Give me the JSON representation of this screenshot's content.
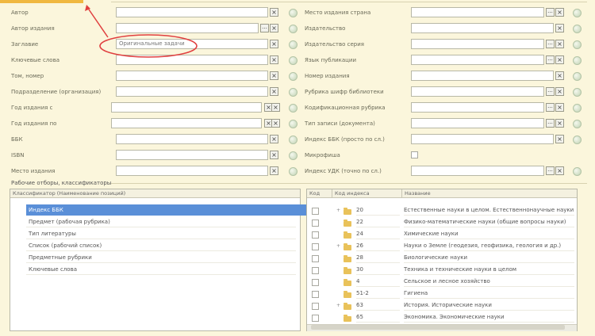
{
  "colors": {
    "background": "#fbf6dc",
    "annotation": "#e04040",
    "selected_row": "#5a8fd8"
  },
  "left_fields": [
    {
      "label": "Автор",
      "value": ""
    },
    {
      "label": "Автор издания",
      "value": ""
    },
    {
      "label": "Заглавие",
      "value": "Оригинальные задачи"
    },
    {
      "label": "Ключевые слова",
      "value": ""
    },
    {
      "label": "Том, номер",
      "value": ""
    },
    {
      "label": "Подразделение (организация)",
      "value": ""
    },
    {
      "label": "Год издания с",
      "value": ""
    },
    {
      "label": "Год издания по",
      "value": ""
    },
    {
      "label": "ББК",
      "value": ""
    },
    {
      "label": "ISBN",
      "value": ""
    },
    {
      "label": "Место издания",
      "value": ""
    }
  ],
  "right_fields": [
    {
      "label": "Место издания страна",
      "value": ""
    },
    {
      "label": "Издательство",
      "value": ""
    },
    {
      "label": "Издательство серия",
      "value": ""
    },
    {
      "label": "Язык публикации",
      "value": ""
    },
    {
      "label": "Номер издания",
      "value": ""
    },
    {
      "label": "Рубрика шифр библиотеки",
      "value": ""
    },
    {
      "label": "Кодификационная рубрика",
      "value": ""
    },
    {
      "label": "Тип записи (документа)",
      "value": ""
    },
    {
      "label": "Индекс ББК (просто по сл.)",
      "value": ""
    },
    {
      "label": "Микрофиша",
      "value": ""
    },
    {
      "label": "Индекс УДК (точно по сл.)",
      "value": ""
    }
  ],
  "section_title": "Рабочие отборы, классификаторы",
  "left_table": {
    "header": "Классификатор (Наименование позиций)",
    "rows": [
      "Индекс ББК",
      "Предмет (рабочая рубрика)",
      "Тип литературы",
      "Список (рабочий список)",
      "Предметные рубрики",
      "Ключевые слова"
    ],
    "selected_index": 0
  },
  "right_table": {
    "headers": [
      "Код",
      "Код индекса",
      "Название"
    ],
    "rows": [
      {
        "code": "20",
        "name": "Естественные науки в целом. Естественнонаучные науки",
        "expand": "+"
      },
      {
        "code": "22",
        "name": "Физико-математические науки (общие вопросы науки)",
        "expand": ""
      },
      {
        "code": "24",
        "name": "Химические науки",
        "expand": ""
      },
      {
        "code": "26",
        "name": "Науки о Земле (геодезия, геофизика, геология и др.)",
        "expand": "+"
      },
      {
        "code": "28",
        "name": "Биологические науки",
        "expand": ""
      },
      {
        "code": "30",
        "name": "Техника и технические науки в целом",
        "expand": ""
      },
      {
        "code": "4",
        "name": "Сельское и лесное хозяйство",
        "expand": ""
      },
      {
        "code": "51-2",
        "name": "Гигиена",
        "expand": ""
      },
      {
        "code": "63",
        "name": "История. Исторические науки",
        "expand": "+"
      },
      {
        "code": "65",
        "name": "Экономика. Экономические науки",
        "expand": ""
      }
    ]
  },
  "icons": {
    "clear": "×",
    "dropdown": "...",
    "checkbox": "checkbox-icon",
    "folder": "folder-icon",
    "open": "circle-open-icon"
  }
}
